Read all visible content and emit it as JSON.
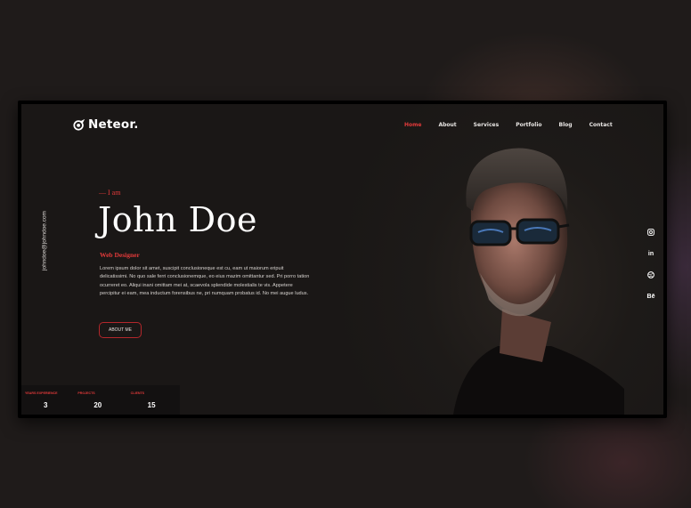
{
  "brand": {
    "name": "Neteor."
  },
  "nav": {
    "items": [
      "Home",
      "About",
      "Services",
      "Portfolio",
      "Blog",
      "Contact"
    ],
    "active": "Home"
  },
  "sidebar": {
    "email": "johndoe@johndoe.com"
  },
  "hero": {
    "intro": "— I am",
    "name": "John Doe",
    "role": "Web Designer",
    "bio": "Lorem ipsum dolor sit amet, suscipit conclusioneque est cu, eam ut maiorum eripuit delicatissimi. No quo sale ferri conclusionemque, eo eius mazim omittantur sed. Pri porro tation ocurreret eo. Aliqui inani omittam mei at, scaevola splendide molestialis te vis. Appetere percipitur ei eam, mea inductum forensibus ne, pri numquam probatus id. No mei augue ludus.",
    "button": "ABOUT ME"
  },
  "stats": [
    {
      "label": "YEARS EXPERIENCE",
      "value": "3"
    },
    {
      "label": "PROJECTS",
      "value": "20"
    },
    {
      "label": "CLIENTS",
      "value": "15"
    }
  ],
  "social": [
    "instagram-icon",
    "linkedin-icon",
    "dribbble-icon",
    "behance-icon"
  ],
  "colors": {
    "accent": "#e23a3a",
    "background": "#1d1a18",
    "text": "#ffffff"
  }
}
